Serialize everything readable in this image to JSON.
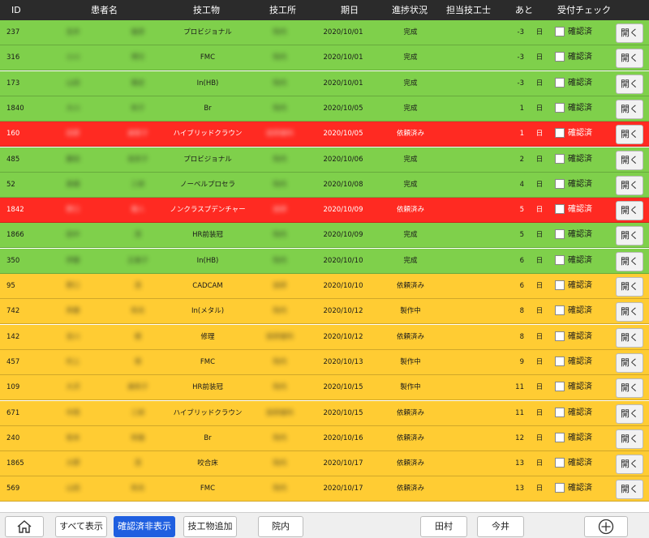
{
  "header": {
    "id": "ID",
    "patient": "患者名",
    "item": "技工物",
    "lab": "技工所",
    "date": "期日",
    "status": "進捗状況",
    "technician": "担当技工士",
    "remaining": "あと",
    "check": "受付チェック"
  },
  "colors": {
    "green": "#7fd04b",
    "red": "#ff2a22",
    "yellow": "#ffcc33",
    "header": "#2b2b2b",
    "active": "#1f5fe0"
  },
  "rows": [
    {
      "id": "237",
      "last": "吉井",
      "first": "雄彦",
      "item": "プロビジョナル",
      "lab": "院内",
      "date": "2020/10/01",
      "status": "完成",
      "days": "-3",
      "unit": "日",
      "check": "確認済",
      "open": "開く",
      "color": "green"
    },
    {
      "id": "316",
      "last": "小川",
      "first": "博文",
      "item": "FMC",
      "lab": "院内",
      "date": "2020/10/01",
      "status": "完成",
      "days": "-3",
      "unit": "日",
      "check": "確認済",
      "open": "開く",
      "color": "green"
    },
    {
      "id": "173",
      "last": "山田",
      "first": "雅史",
      "item": "In(HB)",
      "lab": "院内",
      "date": "2020/10/01",
      "status": "完成",
      "days": "-3",
      "unit": "日",
      "check": "確認済",
      "open": "開く",
      "color": "green"
    },
    {
      "id": "1840",
      "last": "大川",
      "first": "和子",
      "item": "Br",
      "lab": "院内",
      "date": "2020/10/05",
      "status": "完成",
      "days": "1",
      "unit": "日",
      "check": "確認済",
      "open": "開く",
      "color": "green"
    },
    {
      "id": "160",
      "last": "田原",
      "first": "美智子",
      "item": "ハイブリッドクラウン",
      "lab": "技研歯科",
      "date": "2020/10/05",
      "status": "依頼済み",
      "days": "1",
      "unit": "日",
      "check": "確認済",
      "open": "開く",
      "color": "red"
    },
    {
      "id": "485",
      "last": "藤田",
      "first": "佳奈子",
      "item": "プロビジョナル",
      "lab": "院内",
      "date": "2020/10/06",
      "status": "完成",
      "days": "2",
      "unit": "日",
      "check": "確認済",
      "open": "開く",
      "color": "green"
    },
    {
      "id": "52",
      "last": "高橋",
      "first": "三郎",
      "item": "ノーベルプロセラ",
      "lab": "院内",
      "date": "2020/10/08",
      "status": "完成",
      "days": "4",
      "unit": "日",
      "check": "確認済",
      "open": "開く",
      "color": "green"
    },
    {
      "id": "1842",
      "last": "野口",
      "first": "雅人",
      "item": "ノンクラスプデンチャー",
      "lab": "技研",
      "date": "2020/10/09",
      "status": "依頼済み",
      "days": "5",
      "unit": "日",
      "check": "確認済",
      "open": "開く",
      "color": "red"
    },
    {
      "id": "1866",
      "last": "田中",
      "first": "茂",
      "item": "HR前装冠",
      "lab": "院内",
      "date": "2020/10/09",
      "status": "完成",
      "days": "5",
      "unit": "日",
      "check": "確認済",
      "open": "開く",
      "color": "green"
    },
    {
      "id": "350",
      "last": "伊藤",
      "first": "正美子",
      "item": "In(HB)",
      "lab": "院内",
      "date": "2020/10/10",
      "status": "完成",
      "days": "6",
      "unit": "日",
      "check": "確認済",
      "open": "開く",
      "color": "green"
    },
    {
      "id": "95",
      "last": "野口",
      "first": "茂",
      "item": "CADCAM",
      "lab": "技研",
      "date": "2020/10/10",
      "status": "依頼済み",
      "days": "6",
      "unit": "日",
      "check": "確認済",
      "open": "開く",
      "color": "yellow"
    },
    {
      "id": "742",
      "last": "斉藤",
      "first": "和夫",
      "item": "In(メタル)",
      "lab": "院内",
      "date": "2020/10/12",
      "status": "製作中",
      "days": "8",
      "unit": "日",
      "check": "確認済",
      "open": "開く",
      "color": "yellow"
    },
    {
      "id": "142",
      "last": "吉川",
      "first": "健",
      "item": "修理",
      "lab": "技研歯科",
      "date": "2020/10/12",
      "status": "依頼済み",
      "days": "8",
      "unit": "日",
      "check": "確認済",
      "open": "開く",
      "color": "yellow"
    },
    {
      "id": "457",
      "last": "村上",
      "first": "保",
      "item": "FMC",
      "lab": "院内",
      "date": "2020/10/13",
      "status": "製作中",
      "days": "9",
      "unit": "日",
      "check": "確認済",
      "open": "開く",
      "color": "yellow"
    },
    {
      "id": "109",
      "last": "大沢",
      "first": "美和子",
      "item": "HR前装冠",
      "lab": "院内",
      "date": "2020/10/15",
      "status": "製作中",
      "days": "11",
      "unit": "日",
      "check": "確認済",
      "open": "開く",
      "color": "yellow"
    },
    {
      "id": "671",
      "last": "中西",
      "first": "三郎",
      "item": "ハイブリッドクラウン",
      "lab": "技研歯科",
      "date": "2020/10/15",
      "status": "依頼済み",
      "days": "11",
      "unit": "日",
      "check": "確認済",
      "open": "開く",
      "color": "yellow"
    },
    {
      "id": "240",
      "last": "坂本",
      "first": "和雄",
      "item": "Br",
      "lab": "院内",
      "date": "2020/10/16",
      "status": "依頼済み",
      "days": "12",
      "unit": "日",
      "check": "確認済",
      "open": "開く",
      "color": "yellow"
    },
    {
      "id": "1865",
      "last": "大野",
      "first": "茂",
      "item": "咬合床",
      "lab": "院内",
      "date": "2020/10/17",
      "status": "依頼済み",
      "days": "13",
      "unit": "日",
      "check": "確認済",
      "open": "開く",
      "color": "yellow"
    },
    {
      "id": "569",
      "last": "山田",
      "first": "和夫",
      "item": "FMC",
      "lab": "院内",
      "date": "2020/10/17",
      "status": "依頼済み",
      "days": "13",
      "unit": "日",
      "check": "確認済",
      "open": "開く",
      "color": "yellow"
    }
  ],
  "toolbar": {
    "home_icon": "home-icon",
    "show_all": "すべて表示",
    "hide_confirmed": "確認済非表示",
    "add_item": "技工物追加",
    "in_house": "院内",
    "tamura": "田村",
    "imai": "今井",
    "add_icon": "plus-circle-icon"
  }
}
